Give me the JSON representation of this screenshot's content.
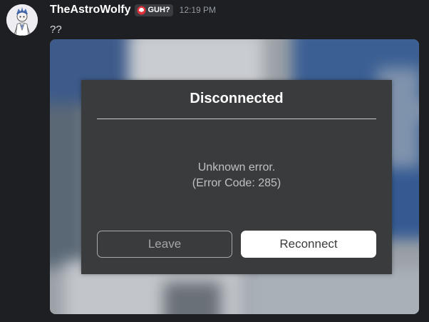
{
  "message": {
    "username": "TheAstroWolfy",
    "tag": {
      "icon": "red-ring-icon",
      "label": "GUH?"
    },
    "timestamp": "12:19 PM",
    "text": "??"
  },
  "dialog": {
    "title": "Disconnected",
    "message_line1": "Unknown error.",
    "message_line2": "(Error Code: 285)",
    "leave_label": "Leave",
    "reconnect_label": "Reconnect"
  },
  "colors": {
    "background": "#1e1f22",
    "dialog_background": "#393b3d",
    "tag_icon": "#e0303a"
  }
}
